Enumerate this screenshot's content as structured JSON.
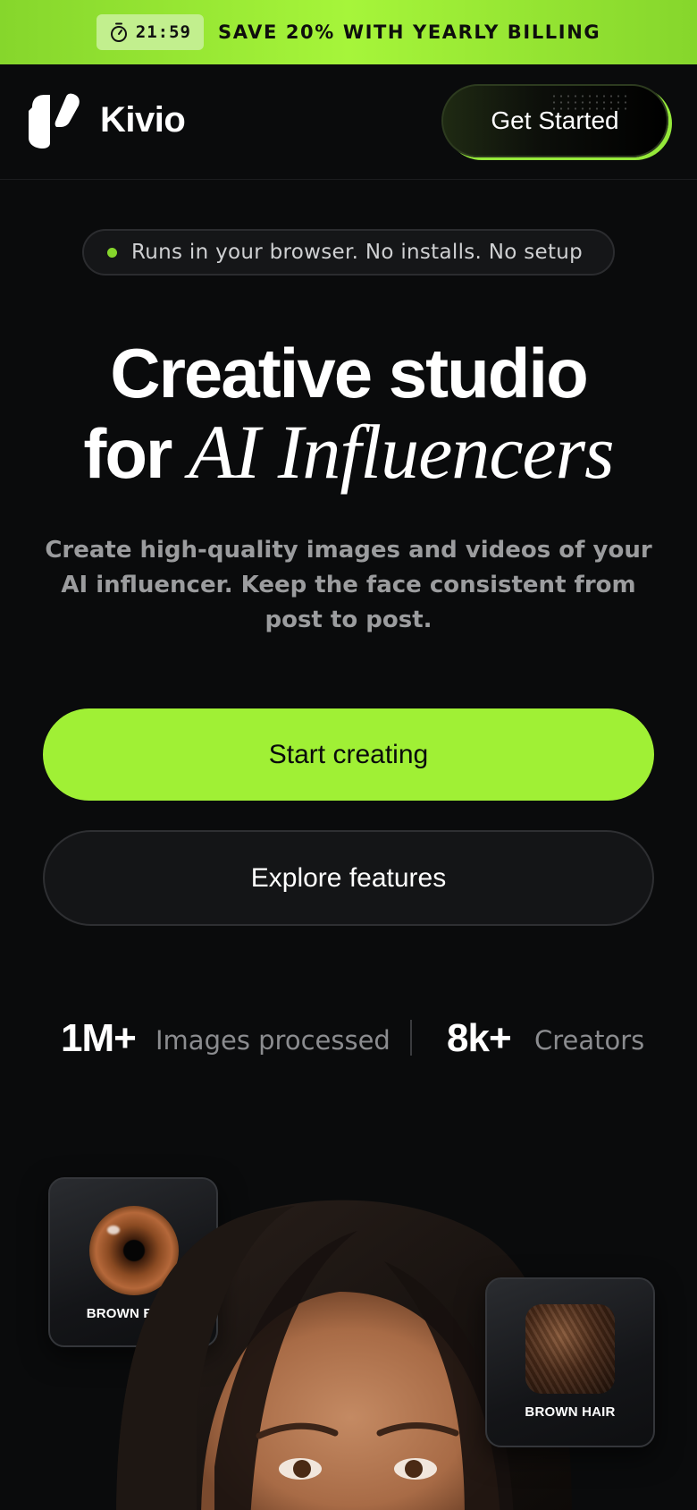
{
  "promo": {
    "timer": "21:59",
    "text": "SAVE 20% WITH YEARLY BILLING"
  },
  "header": {
    "brand": "Kivio",
    "cta": "Get Started"
  },
  "pill": {
    "text": "Runs in your browser. No installs. No setup"
  },
  "hero": {
    "title_line1": "Creative studio",
    "title_line2_prefix": "for ",
    "title_line2_italic": "AI Influencers",
    "subtitle": "Create high-quality images and videos of your AI influencer. Keep the face consistent from post to post.",
    "primary_button": "Start creating",
    "secondary_button": "Explore features"
  },
  "stats": [
    {
      "value": "1M+",
      "label": "Images processed"
    },
    {
      "value": "8k+",
      "label": "Creators"
    }
  ],
  "cards": {
    "eye_label": "BROWN EYES",
    "hair_label": "BROWN HAIR"
  },
  "colors": {
    "accent": "#a0f035",
    "background": "#0a0b0c",
    "muted_text": "#9b9c9e"
  }
}
